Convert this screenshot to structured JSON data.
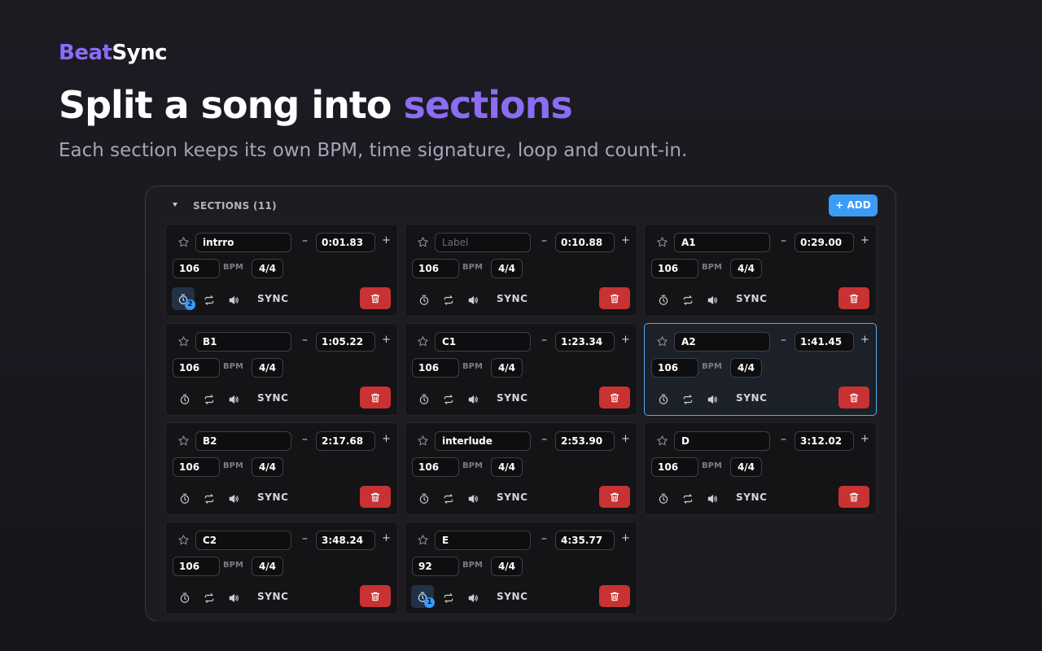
{
  "brand": {
    "part1": "Beat",
    "part2": "Sync"
  },
  "headline": {
    "text": "Split a song into ",
    "highlight": "sections"
  },
  "subtitle": "Each section keeps its own BPM, time signature, loop and count-in.",
  "colors": {
    "accent": "#8b6cf3",
    "primary_button": "#3b9cf6",
    "danger": "#c83232",
    "active_border": "#5aa7f0"
  },
  "sections_panel": {
    "title": "SECTIONS (11)",
    "add_label": "+ ADD",
    "bpm_label": "BPM",
    "sync_label": "SYNC",
    "label_placeholder": "Label",
    "minus": "–",
    "plus": "+"
  },
  "sections": [
    {
      "label": "intrro",
      "time": "0:01.83",
      "bpm": "106",
      "ts": "4/4",
      "countin": "2",
      "active": false
    },
    {
      "label": "",
      "time": "0:10.88",
      "bpm": "106",
      "ts": "4/4",
      "countin": "",
      "active": false
    },
    {
      "label": "A1",
      "time": "0:29.00",
      "bpm": "106",
      "ts": "4/4",
      "countin": "",
      "active": false
    },
    {
      "label": "B1",
      "time": "1:05.22",
      "bpm": "106",
      "ts": "4/4",
      "countin": "",
      "active": false
    },
    {
      "label": "C1",
      "time": "1:23.34",
      "bpm": "106",
      "ts": "4/4",
      "countin": "",
      "active": false
    },
    {
      "label": "A2",
      "time": "1:41.45",
      "bpm": "106",
      "ts": "4/4",
      "countin": "",
      "active": true
    },
    {
      "label": "B2",
      "time": "2:17.68",
      "bpm": "106",
      "ts": "4/4",
      "countin": "",
      "active": false
    },
    {
      "label": "interlude",
      "time": "2:53.90",
      "bpm": "106",
      "ts": "4/4",
      "countin": "",
      "active": false
    },
    {
      "label": "D",
      "time": "3:12.02",
      "bpm": "106",
      "ts": "4/4",
      "countin": "",
      "active": false
    },
    {
      "label": "C2",
      "time": "3:48.24",
      "bpm": "106",
      "ts": "4/4",
      "countin": "",
      "active": false
    },
    {
      "label": "E",
      "time": "4:35.77",
      "bpm": "92",
      "ts": "4/4",
      "countin": "1",
      "active": false
    }
  ]
}
